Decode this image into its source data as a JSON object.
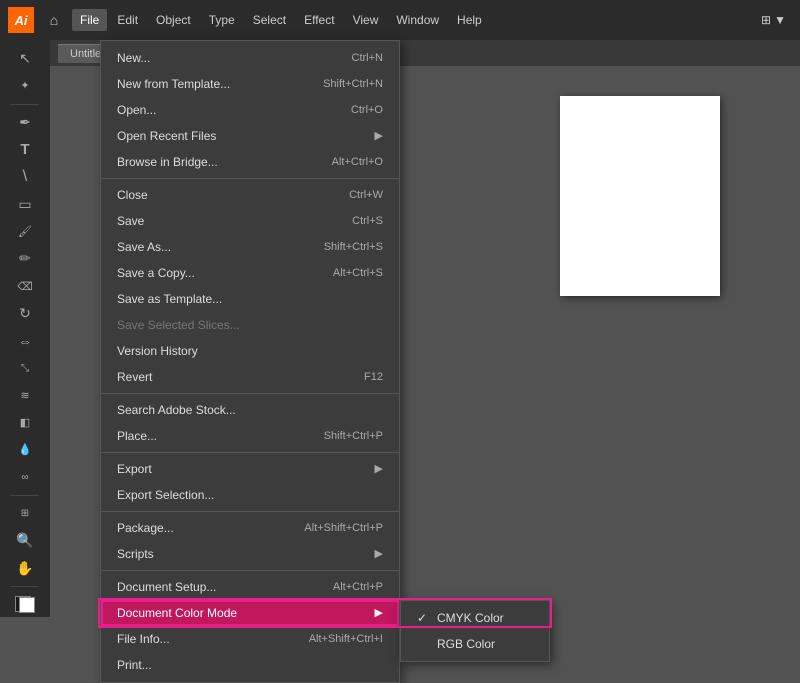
{
  "app": {
    "logo": "Ai",
    "title": "Untitled"
  },
  "menubar": {
    "items": [
      "File",
      "Edit",
      "Object",
      "Type",
      "Select",
      "Effect",
      "View",
      "Window",
      "Help"
    ]
  },
  "file_menu": {
    "items": [
      {
        "label": "New...",
        "shortcut": "Ctrl+N",
        "disabled": false,
        "has_arrow": false,
        "id": "new"
      },
      {
        "label": "New from Template...",
        "shortcut": "Shift+Ctrl+N",
        "disabled": false,
        "has_arrow": false,
        "id": "new-from-template"
      },
      {
        "label": "Open...",
        "shortcut": "Ctrl+O",
        "disabled": false,
        "has_arrow": false,
        "id": "open"
      },
      {
        "label": "Open Recent Files",
        "shortcut": "",
        "disabled": false,
        "has_arrow": true,
        "id": "open-recent"
      },
      {
        "label": "Browse in Bridge...",
        "shortcut": "Alt+Ctrl+O",
        "disabled": false,
        "has_arrow": false,
        "id": "browse-bridge"
      },
      {
        "separator": true
      },
      {
        "label": "Close",
        "shortcut": "Ctrl+W",
        "disabled": false,
        "has_arrow": false,
        "id": "close"
      },
      {
        "label": "Save",
        "shortcut": "Ctrl+S",
        "disabled": false,
        "has_arrow": false,
        "id": "save"
      },
      {
        "label": "Save As...",
        "shortcut": "Shift+Ctrl+S",
        "disabled": false,
        "has_arrow": false,
        "id": "save-as"
      },
      {
        "label": "Save a Copy...",
        "shortcut": "Alt+Ctrl+S",
        "disabled": false,
        "has_arrow": false,
        "id": "save-copy"
      },
      {
        "label": "Save as Template...",
        "shortcut": "",
        "disabled": false,
        "has_arrow": false,
        "id": "save-as-template"
      },
      {
        "label": "Save Selected Slices...",
        "shortcut": "",
        "disabled": true,
        "has_arrow": false,
        "id": "save-selected-slices"
      },
      {
        "label": "Version History",
        "shortcut": "",
        "disabled": false,
        "has_arrow": false,
        "id": "version-history"
      },
      {
        "label": "Revert",
        "shortcut": "F12",
        "disabled": false,
        "has_arrow": false,
        "id": "revert"
      },
      {
        "separator": true
      },
      {
        "label": "Search Adobe Stock...",
        "shortcut": "",
        "disabled": false,
        "has_arrow": false,
        "id": "search-stock"
      },
      {
        "label": "Place...",
        "shortcut": "Shift+Ctrl+P",
        "disabled": false,
        "has_arrow": false,
        "id": "place"
      },
      {
        "separator": true
      },
      {
        "label": "Export",
        "shortcut": "",
        "disabled": false,
        "has_arrow": true,
        "id": "export"
      },
      {
        "label": "Export Selection...",
        "shortcut": "",
        "disabled": false,
        "has_arrow": false,
        "id": "export-selection"
      },
      {
        "separator": true
      },
      {
        "label": "Package...",
        "shortcut": "Alt+Shift+Ctrl+P",
        "disabled": false,
        "has_arrow": false,
        "id": "package"
      },
      {
        "label": "Scripts",
        "shortcut": "",
        "disabled": false,
        "has_arrow": true,
        "id": "scripts"
      },
      {
        "separator": true
      },
      {
        "label": "Document Setup...",
        "shortcut": "Alt+Ctrl+P",
        "disabled": false,
        "has_arrow": false,
        "id": "doc-setup"
      },
      {
        "label": "Document Color Mode",
        "shortcut": "",
        "disabled": false,
        "has_arrow": true,
        "id": "doc-color-mode",
        "highlighted": true
      },
      {
        "label": "File Info...",
        "shortcut": "Alt+Shift+Ctrl+I",
        "disabled": false,
        "has_arrow": false,
        "id": "file-info"
      },
      {
        "label": "Print...",
        "shortcut": "",
        "disabled": false,
        "has_arrow": false,
        "id": "print"
      }
    ]
  },
  "color_mode_submenu": {
    "items": [
      {
        "label": "CMYK Color",
        "checked": true,
        "id": "cmyk"
      },
      {
        "label": "RGB Color",
        "checked": false,
        "id": "rgb"
      }
    ]
  },
  "toolbar": {
    "tools": [
      "↖",
      "✋",
      "⬛",
      "✏",
      "⬜",
      "◎",
      "✒",
      "🖊",
      "✂",
      "T",
      "🌀",
      "⭕",
      "▱",
      "◈",
      "🔍",
      "🖐"
    ]
  },
  "tab": {
    "label": "Untitled",
    "close": "×"
  }
}
